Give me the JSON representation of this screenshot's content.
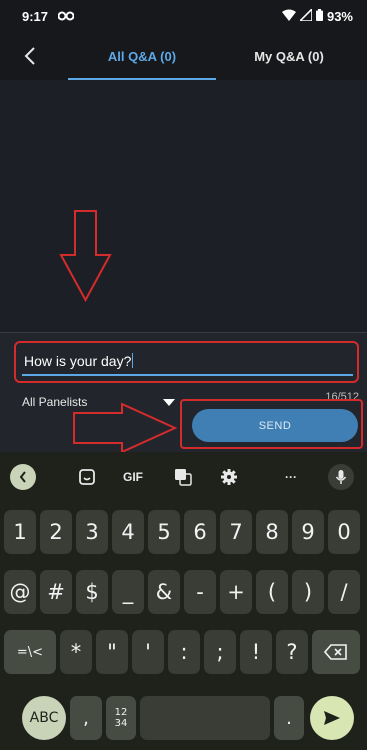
{
  "status_bar": {
    "time": "9:17",
    "battery": "93%"
  },
  "tabs": [
    {
      "label": "All Q&A (0)",
      "active": true
    },
    {
      "label": "My Q&A (0)",
      "active": false
    }
  ],
  "compose": {
    "input_value": "How is your day?",
    "counter": "16/512",
    "recipient": "All Panelists",
    "send_label": "SEND"
  },
  "keyboard_toolbar": {
    "gif": "GIF",
    "more": "···"
  },
  "keyboard": {
    "row1": [
      "1",
      "2",
      "3",
      "4",
      "5",
      "6",
      "7",
      "8",
      "9",
      "0"
    ],
    "row2": [
      "@",
      "#",
      "$",
      "_",
      "&",
      "-",
      "+",
      "(",
      ")",
      "/"
    ],
    "row3": [
      "=\\<",
      "*",
      "\"",
      "'",
      ":",
      ";",
      "!",
      "?"
    ],
    "bottom": {
      "abc": "ABC",
      "comma": ",",
      "numpad": "12\n34",
      "period": "."
    }
  },
  "colors": {
    "accent": "#5ea8e6",
    "send": "#3f7fb4",
    "annotation": "#d42b2b",
    "enter": "#d8e6b4"
  },
  "icons": [
    "back-icon",
    "wifi-icon",
    "signal-icon",
    "battery-icon",
    "sticker-icon",
    "translate-icon",
    "settings-icon",
    "mic-icon",
    "backspace-icon",
    "send-arrow-icon"
  ]
}
